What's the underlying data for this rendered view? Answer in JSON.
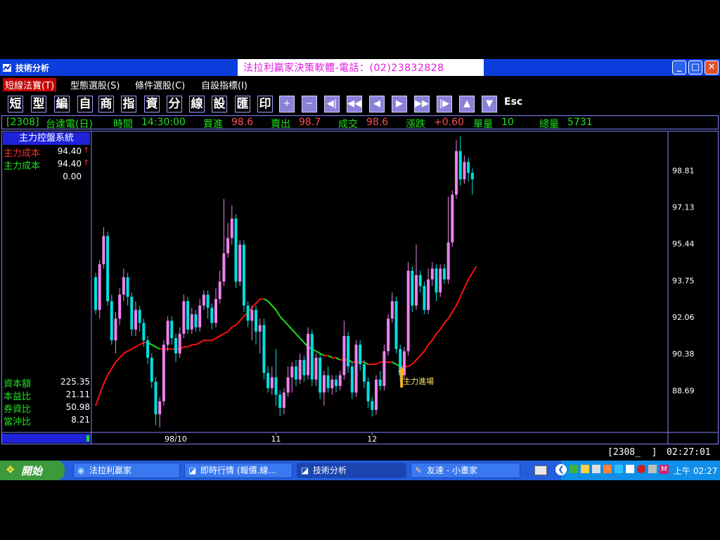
{
  "window": {
    "title": "技術分析",
    "banner": "法拉利贏家決策軟體-電話：(02)23832828",
    "controls": {
      "minimize": "_",
      "maximize": "□",
      "close": "✕"
    }
  },
  "menu": [
    {
      "label": "短線法寶(T)"
    },
    {
      "label": "型態選股(S)"
    },
    {
      "label": "條件選股(C)"
    },
    {
      "label": "自設指標(I)"
    }
  ],
  "toolbar": {
    "chars": [
      "短",
      "型",
      "編",
      "自",
      "商",
      "指",
      "資",
      "分",
      "線",
      "設",
      "匯",
      "印"
    ],
    "icons": [
      "+",
      "−",
      "◀|",
      "◀◀",
      "◀",
      "▶",
      "▶▶",
      "|▶",
      "▲",
      "▼"
    ],
    "esc": "Esc"
  },
  "quote": {
    "code": "[2308]",
    "name": "台達電(日)",
    "time_label": "時間",
    "time": "14:30:00",
    "bid_label": "買進",
    "bid": "98.6",
    "ask_label": "賣出",
    "ask": "98.7",
    "trade_label": "成交",
    "trade": "98.6",
    "change_label": "漲跌",
    "change": "+0.60",
    "unit_vol_label": "單量",
    "unit_vol": "10",
    "total_vol_label": "總量",
    "total_vol": "5731"
  },
  "left_panel": {
    "title": "主力控盤系統",
    "rows": [
      {
        "label": "主力成本",
        "value": "94.40",
        "arrow": "↑",
        "color": "#ff3030"
      },
      {
        "label": "主力成本",
        "value": "94.40",
        "arrow": "↑",
        "color": "#20e020"
      },
      {
        "label": "",
        "value": "0.00",
        "arrow": "",
        "color": "#ffffff"
      }
    ],
    "stats": [
      {
        "label": "資本額",
        "value": "225.35"
      },
      {
        "label": "本益比",
        "value": "21.11"
      },
      {
        "label": "券資比",
        "value": "50.98"
      },
      {
        "label": "當沖比",
        "value": "8.21"
      }
    ]
  },
  "status_bar": {
    "code_box": "[2308_  ]",
    "clock": "02:27:01"
  },
  "taskbar": {
    "start": "開始",
    "tasks": [
      {
        "label": "法拉利贏家"
      },
      {
        "label": "即時行情 (報價.線..."
      },
      {
        "label": "技術分析"
      },
      {
        "label": "友達 - 小畫家"
      }
    ],
    "time": "上午 02:27"
  },
  "chart_data": {
    "type": "candlestick",
    "y_ticks": [
      "98.81",
      "97.13",
      "95.44",
      "93.75",
      "92.06",
      "90.38",
      "88.69"
    ],
    "ylim": [
      86.8,
      100.6
    ],
    "x_ticks": [
      {
        "label": "98/10",
        "index": 20
      },
      {
        "label": "11",
        "index": 45
      },
      {
        "label": "12",
        "index": 69
      }
    ],
    "annotation": {
      "text": "主力進場",
      "index": 76,
      "price": 89.8
    },
    "colors": {
      "up": "#ee82ee",
      "down": "#00e0e0",
      "cost_up": "#ff1010",
      "cost_down": "#20e020"
    },
    "candles": [
      [
        93.9,
        92.4,
        94.1,
        92.2
      ],
      [
        92.4,
        94.5,
        94.7,
        92.0
      ],
      [
        94.5,
        95.8,
        96.2,
        94.3
      ],
      [
        95.8,
        92.8,
        96.0,
        92.6
      ],
      [
        92.8,
        91.0,
        93.1,
        90.8
      ],
      [
        91.0,
        92.0,
        92.3,
        90.4
      ],
      [
        92.0,
        93.1,
        93.4,
        91.7
      ],
      [
        93.1,
        93.9,
        94.3,
        92.8
      ],
      [
        93.9,
        93.0,
        94.1,
        92.6
      ],
      [
        93.0,
        91.5,
        93.2,
        91.2
      ],
      [
        91.5,
        92.4,
        92.8,
        91.2
      ],
      [
        92.4,
        91.8,
        92.6,
        91.4
      ],
      [
        91.8,
        91.0,
        92.0,
        90.7
      ],
      [
        91.0,
        90.2,
        91.2,
        89.9
      ],
      [
        90.2,
        89.1,
        90.4,
        88.8
      ],
      [
        89.1,
        87.6,
        89.3,
        87.1
      ],
      [
        87.6,
        88.2,
        88.4,
        87.0
      ],
      [
        88.2,
        90.8,
        91.0,
        88.0
      ],
      [
        90.8,
        91.9,
        92.1,
        90.5
      ],
      [
        91.9,
        91.1,
        92.1,
        90.8
      ],
      [
        91.1,
        90.4,
        91.3,
        90.0
      ],
      [
        90.4,
        91.3,
        91.6,
        90.2
      ],
      [
        91.3,
        92.8,
        93.1,
        91.1
      ],
      [
        92.8,
        91.5,
        93.0,
        91.3
      ],
      [
        91.5,
        92.2,
        92.5,
        91.3
      ],
      [
        92.2,
        91.6,
        92.4,
        91.4
      ],
      [
        91.6,
        92.6,
        92.9,
        91.4
      ],
      [
        92.6,
        93.1,
        93.3,
        92.4
      ],
      [
        93.1,
        92.5,
        93.3,
        92.0
      ],
      [
        92.5,
        91.8,
        92.7,
        91.5
      ],
      [
        91.8,
        92.9,
        93.4,
        91.6
      ],
      [
        92.9,
        93.7,
        94.2,
        92.7
      ],
      [
        93.7,
        95.0,
        97.5,
        93.5
      ],
      [
        95.0,
        95.7,
        96.4,
        94.8
      ],
      [
        95.7,
        96.6,
        97.2,
        95.4
      ],
      [
        96.6,
        93.7,
        96.8,
        93.4
      ],
      [
        93.7,
        95.4,
        95.6,
        93.5
      ],
      [
        95.4,
        92.6,
        95.6,
        92.3
      ],
      [
        92.6,
        91.9,
        92.8,
        91.6
      ],
      [
        91.9,
        92.4,
        92.6,
        91.0
      ],
      [
        92.4,
        91.4,
        92.6,
        90.8
      ],
      [
        91.4,
        91.7,
        92.0,
        90.4
      ],
      [
        91.7,
        89.5,
        92.0,
        89.2
      ],
      [
        89.5,
        88.8,
        89.8,
        88.6
      ],
      [
        88.8,
        89.3,
        89.8,
        88.5
      ],
      [
        89.3,
        88.5,
        90.6,
        88.0
      ],
      [
        88.5,
        87.9,
        88.7,
        87.5
      ],
      [
        87.9,
        88.6,
        88.8,
        87.6
      ],
      [
        88.6,
        89.3,
        89.8,
        88.4
      ],
      [
        89.3,
        89.8,
        90.0,
        88.6
      ],
      [
        89.8,
        89.2,
        90.1,
        88.9
      ],
      [
        89.2,
        90.1,
        90.4,
        89.0
      ],
      [
        90.1,
        89.4,
        90.3,
        89.1
      ],
      [
        89.4,
        91.3,
        91.6,
        89.2
      ],
      [
        91.3,
        89.2,
        91.5,
        88.9
      ],
      [
        89.2,
        90.2,
        90.4,
        88.9
      ],
      [
        90.2,
        88.6,
        90.4,
        88.3
      ],
      [
        88.6,
        89.4,
        89.6,
        88.0
      ],
      [
        89.4,
        88.8,
        89.8,
        88.6
      ],
      [
        88.8,
        89.2,
        89.4,
        88.5
      ],
      [
        89.2,
        88.9,
        89.4,
        88.6
      ],
      [
        88.9,
        89.4,
        89.6,
        88.7
      ],
      [
        89.4,
        91.2,
        91.9,
        89.2
      ],
      [
        91.2,
        89.8,
        91.4,
        89.5
      ],
      [
        89.8,
        88.6,
        90.0,
        88.3
      ],
      [
        88.6,
        90.8,
        91.0,
        88.4
      ],
      [
        90.8,
        89.9,
        91.0,
        89.6
      ],
      [
        89.9,
        89.1,
        90.1,
        88.8
      ],
      [
        89.1,
        88.2,
        89.3,
        87.9
      ],
      [
        88.2,
        87.8,
        88.4,
        87.5
      ],
      [
        87.8,
        89.2,
        89.4,
        87.6
      ],
      [
        89.2,
        88.9,
        89.6,
        88.7
      ],
      [
        88.9,
        90.5,
        90.8,
        88.7
      ],
      [
        90.5,
        92.0,
        92.2,
        90.3
      ],
      [
        92.0,
        92.8,
        93.2,
        91.8
      ],
      [
        92.8,
        90.6,
        93.0,
        90.4
      ],
      [
        90.6,
        89.4,
        90.8,
        89.1
      ],
      [
        89.4,
        90.5,
        90.7,
        89.2
      ],
      [
        90.5,
        94.2,
        94.6,
        90.3
      ],
      [
        94.2,
        92.6,
        94.4,
        92.3
      ],
      [
        92.6,
        94.0,
        95.4,
        92.4
      ],
      [
        94.0,
        93.5,
        94.2,
        93.2
      ],
      [
        93.5,
        92.4,
        93.7,
        92.2
      ],
      [
        92.4,
        93.8,
        94.3,
        92.2
      ],
      [
        93.8,
        94.3,
        94.6,
        93.5
      ],
      [
        94.3,
        93.2,
        94.5,
        92.8
      ],
      [
        93.2,
        94.3,
        94.5,
        93.0
      ],
      [
        94.3,
        93.8,
        94.5,
        93.6
      ],
      [
        93.8,
        95.5,
        97.6,
        93.6
      ],
      [
        95.5,
        97.7,
        97.9,
        95.3
      ],
      [
        97.7,
        99.7,
        100.2,
        97.5
      ],
      [
        99.7,
        98.4,
        100.4,
        98.1
      ],
      [
        98.4,
        99.2,
        99.5,
        98.2
      ],
      [
        99.2,
        98.7,
        99.4,
        98.3
      ],
      [
        98.7,
        98.4,
        98.9,
        97.7
      ]
    ],
    "cost_line": [
      88.0,
      88.5,
      89.0,
      89.4,
      89.7,
      90.0,
      90.2,
      90.4,
      90.5,
      90.6,
      90.7,
      90.8,
      90.9,
      90.9,
      90.8,
      90.7,
      90.6,
      90.6,
      90.6,
      90.6,
      90.6,
      90.6,
      90.7,
      90.7,
      90.8,
      90.8,
      90.9,
      91.0,
      91.0,
      91.0,
      91.1,
      91.2,
      91.3,
      91.4,
      91.6,
      91.7,
      91.9,
      92.1,
      92.3,
      92.5,
      92.7,
      92.9,
      92.9,
      92.8,
      92.6,
      92.4,
      92.1,
      91.9,
      91.7,
      91.5,
      91.3,
      91.1,
      90.9,
      90.7,
      90.6,
      90.5,
      90.4,
      90.3,
      90.3,
      90.2,
      90.2,
      90.1,
      90.1,
      90.1,
      90.0,
      90.0,
      90.0,
      90.0,
      89.9,
      89.9,
      89.9,
      90.0,
      90.0,
      90.0,
      90.0,
      89.9,
      89.8,
      89.8,
      89.8,
      89.9,
      90.1,
      90.3,
      90.5,
      90.8,
      91.0,
      91.3,
      91.5,
      91.8,
      92.0,
      92.3,
      92.6,
      93.0,
      93.4,
      93.8,
      94.1,
      94.4
    ]
  }
}
